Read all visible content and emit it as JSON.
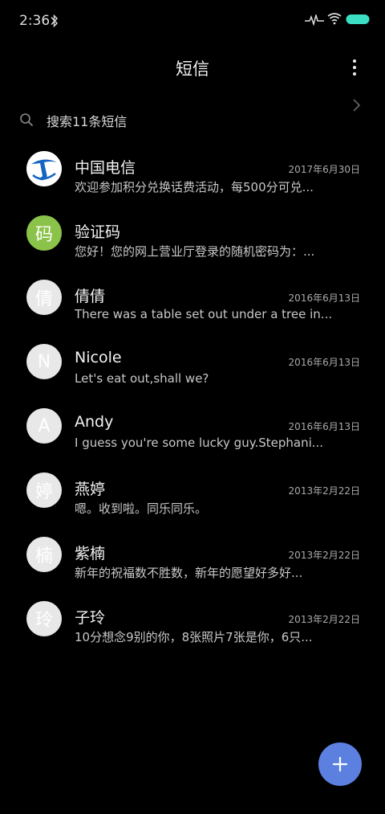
{
  "status_bar": {
    "time": "2:36",
    "icons": [
      "bluetooth-icon",
      "signal-icon",
      "wifi-icon",
      "battery-icon"
    ],
    "battery_color": "#3be0c4"
  },
  "header": {
    "title": "短信",
    "more_icon": "more-vertical-icon"
  },
  "search": {
    "placeholder": "搜索11条短信"
  },
  "conversations": [
    {
      "name": "中国电信",
      "date": "2017年6月30日",
      "preview": "欢迎参加积分兑换话费活动，每500分可兑...",
      "avatar_type": "logo",
      "avatar_text": ""
    },
    {
      "name": "验证码",
      "date": "",
      "preview": "您好！您的网上营业厅登录的随机密码为：...",
      "avatar_type": "green",
      "avatar_text": "码",
      "has_chevron": true
    },
    {
      "name": "倩倩",
      "date": "2016年6月13日",
      "preview": "There was a table set out under a tree in...",
      "avatar_type": "letter",
      "avatar_text": "倩"
    },
    {
      "name": "Nicole",
      "date": "2016年6月13日",
      "preview": "Let's eat out,shall we?",
      "avatar_type": "letter",
      "avatar_text": "N"
    },
    {
      "name": "Andy",
      "date": "2016年6月13日",
      "preview": "I guess you're some lucky guy.Stephani...",
      "avatar_type": "letter",
      "avatar_text": "A"
    },
    {
      "name": "燕婷",
      "date": "2013年2月22日",
      "preview": "嗯。收到啦。同乐同乐。",
      "avatar_type": "letter",
      "avatar_text": "婷"
    },
    {
      "name": "紫楠",
      "date": "2013年2月22日",
      "preview": "新年的祝福数不胜数，新年的愿望好多好...",
      "avatar_type": "letter",
      "avatar_text": "楠"
    },
    {
      "name": "子玲",
      "date": "2013年2月22日",
      "preview": "10分想念9别的你，8张照片7张是你，6只...",
      "avatar_type": "letter",
      "avatar_text": "玲"
    }
  ],
  "fab": {
    "icon": "plus-icon",
    "color": "#5c80e0"
  }
}
